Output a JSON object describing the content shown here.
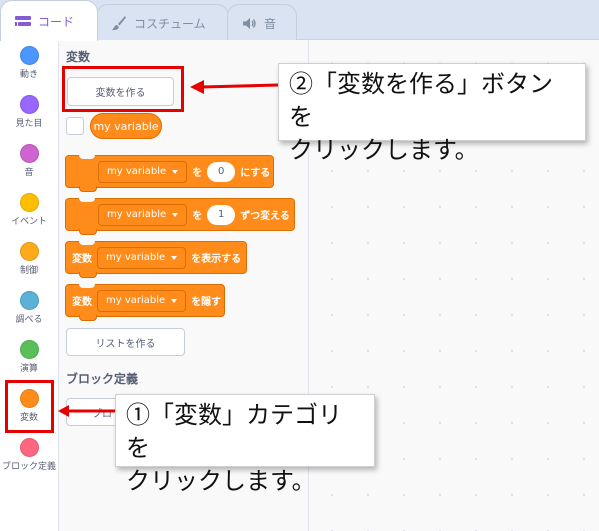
{
  "tabs": [
    {
      "label": "コード",
      "icon": "code-icon",
      "active": true
    },
    {
      "label": "コスチューム",
      "icon": "brush-icon",
      "active": false
    },
    {
      "label": "音",
      "icon": "speaker-icon",
      "active": false
    }
  ],
  "categories": [
    {
      "label": "動き",
      "color": "#4c97ff"
    },
    {
      "label": "見た目",
      "color": "#9966ff"
    },
    {
      "label": "音",
      "color": "#cf63cf"
    },
    {
      "label": "イベント",
      "color": "#ffbf00"
    },
    {
      "label": "制御",
      "color": "#ffab19"
    },
    {
      "label": "調べる",
      "color": "#5cb1d6"
    },
    {
      "label": "演算",
      "color": "#59c059"
    },
    {
      "label": "変数",
      "color": "#ff8c1a",
      "selected": true
    },
    {
      "label": "ブロック定義",
      "color": "#ff6680"
    }
  ],
  "palette": {
    "variables_title": "変数",
    "make_variable_button": "変数を作る",
    "variable_reporter": "my variable",
    "blocks": {
      "set": {
        "var": "my variable",
        "to": "を",
        "value": "0",
        "suffix": "にする"
      },
      "change": {
        "var": "my variable",
        "by": "を",
        "value": "1",
        "suffix": "ずつ変える"
      },
      "show": {
        "prefix": "変数",
        "var": "my variable",
        "suffix": "を表示する"
      },
      "hide": {
        "prefix": "変数",
        "var": "my variable",
        "suffix": "を隠す"
      }
    },
    "make_list_button": "リストを作る",
    "my_blocks_title": "ブロック定義",
    "make_block_button_partial": "ブロ"
  },
  "annotations": {
    "step1": {
      "line1": "①「変数」カテゴリを",
      "line2": "クリックします。"
    },
    "step2": {
      "line1": "②「変数を作る」ボタンを",
      "line2": "クリックします。"
    },
    "highlight_color": "#e60000"
  }
}
